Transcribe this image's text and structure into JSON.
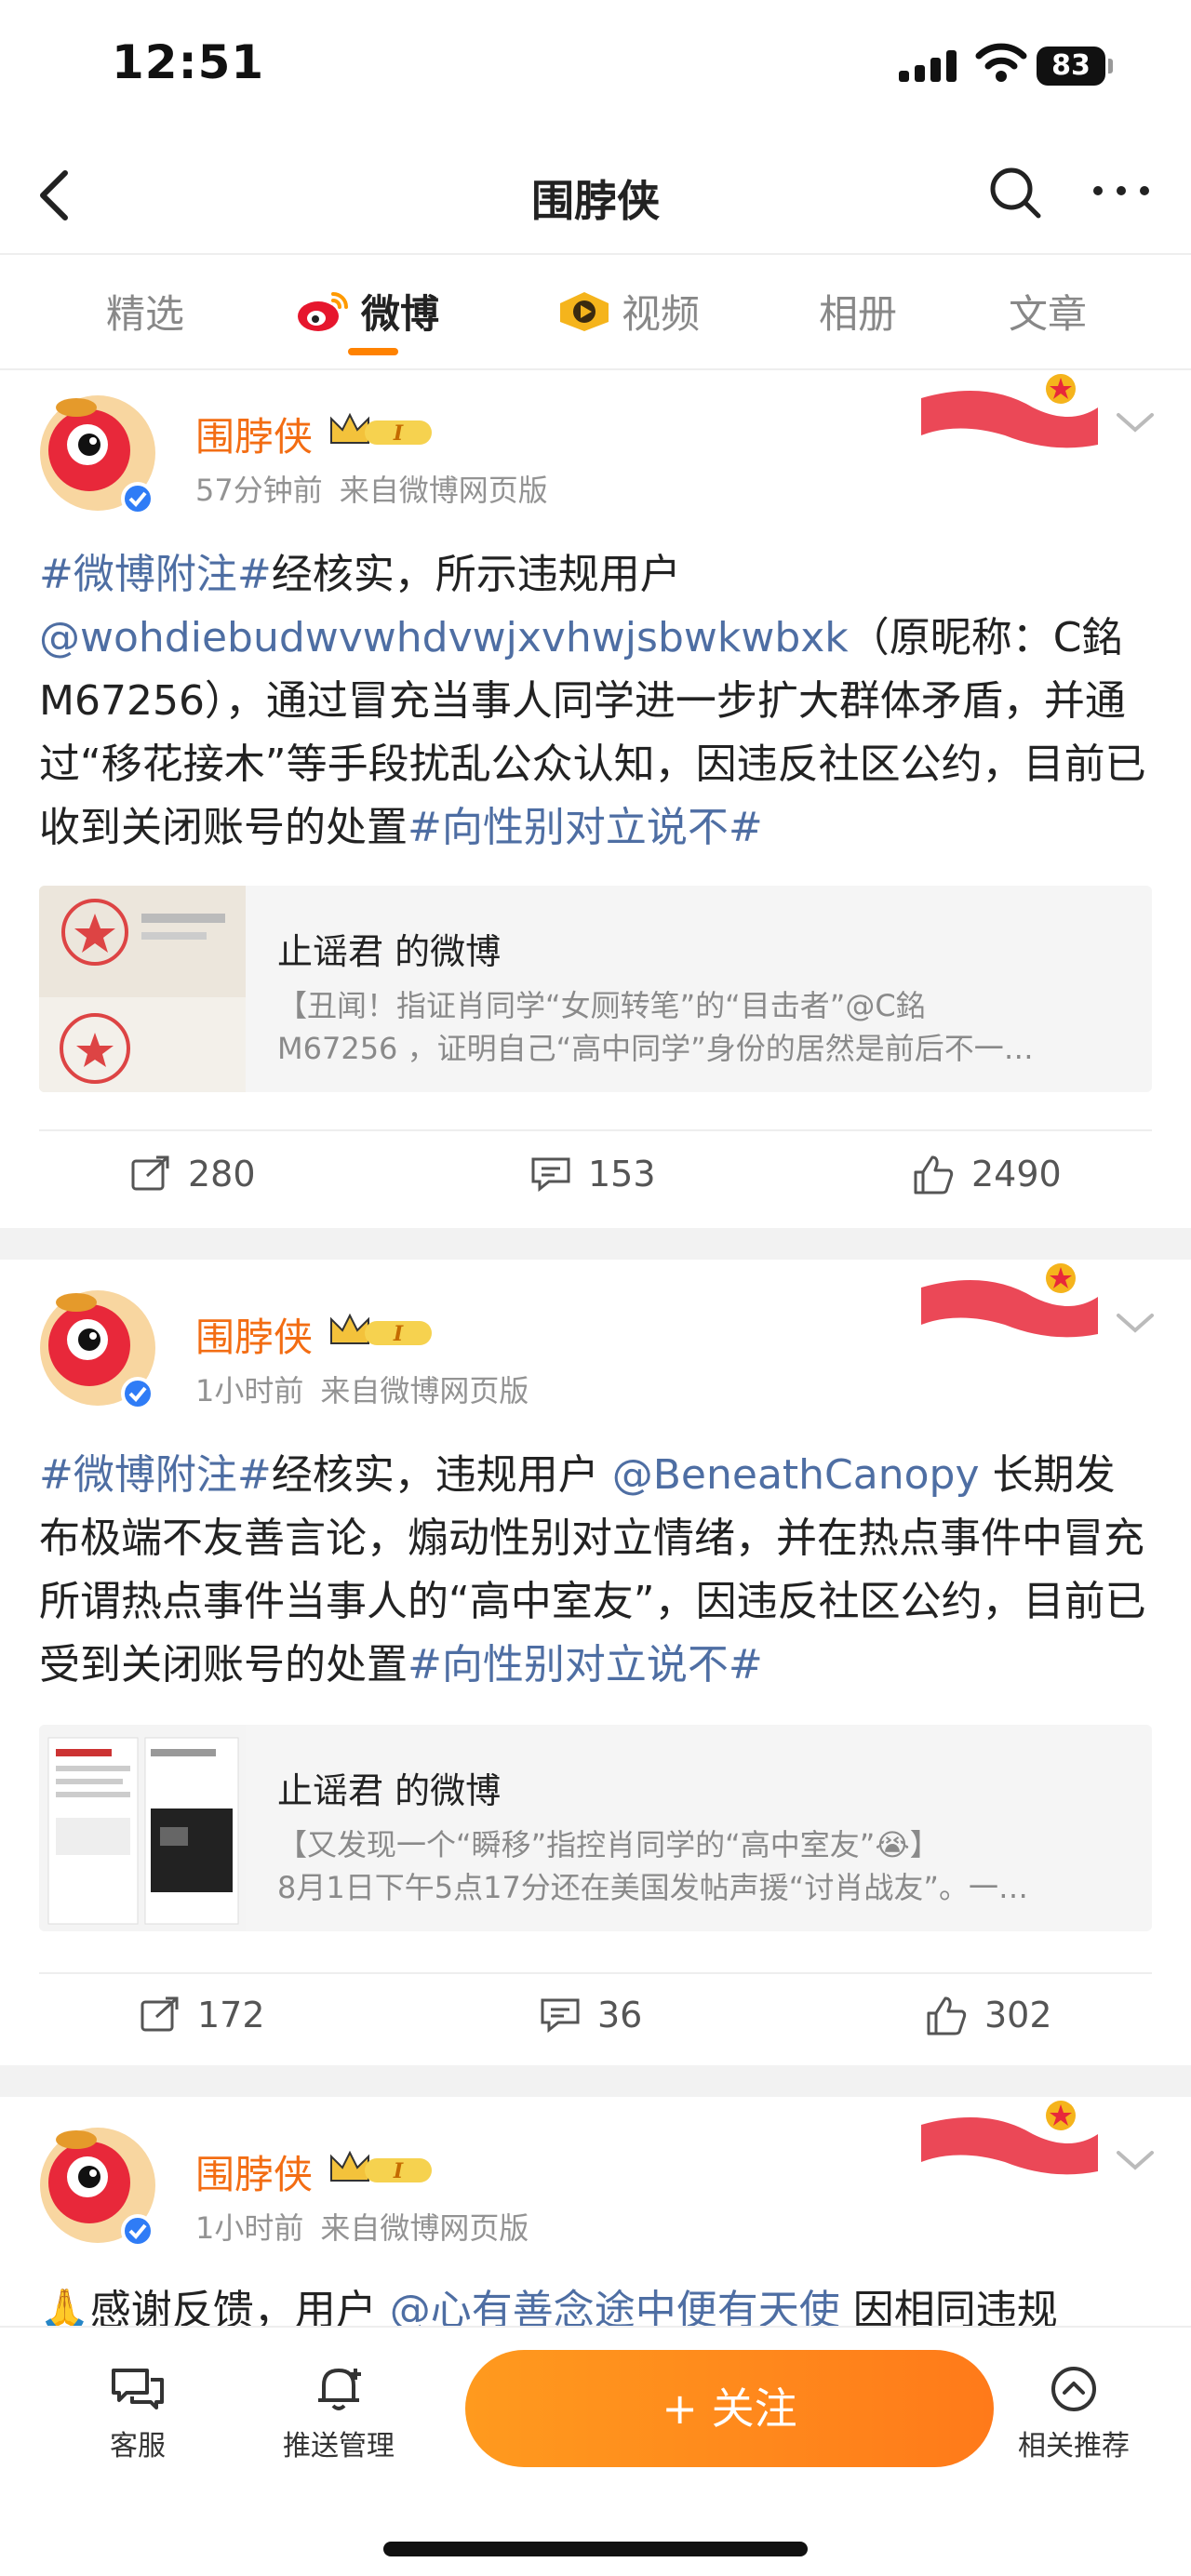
{
  "status": {
    "time": "12:51",
    "battery": "83"
  },
  "nav": {
    "title": "围脖侠"
  },
  "tabs": [
    {
      "label": "精选"
    },
    {
      "label": "微博"
    },
    {
      "label": "视频"
    },
    {
      "label": "相册"
    },
    {
      "label": "文章"
    }
  ],
  "posts": [
    {
      "username": "围脖侠",
      "time": "57分钟前",
      "source": "来自微博网页版",
      "text_parts": [
        "#微博附注#",
        "经核实，所示违规用户",
        "@wohdiebudwvwhdvwjxvhwjsbwkwbxk",
        "（原昵称：C銘M67256），通过冒充当事人同学进一步扩大群体矛盾，并通过“移花接木”等手段扰乱公众认知，因违反社区公约，目前已收到关闭账号的处置",
        "#向性别对立说不#"
      ],
      "quote": {
        "title": "止谣君 的微博",
        "line1": "【丑闻！指证肖同学“女厕转笔”的“目击者”@C銘",
        "line2": "M67256 ，证明自己“高中同学”身份的居然是前后不一…"
      },
      "reposts": "280",
      "comments": "153",
      "likes": "2490"
    },
    {
      "username": "围脖侠",
      "time": "1小时前",
      "source": "来自微博网页版",
      "text_parts": [
        "#微博附注#",
        "经核实，违规用户 ",
        "@BeneathCanopy",
        " 长期发布极端不友善言论，煽动性别对立情绪，并在热点事件中冒充所谓热点事件当事人的“高中室友”，因违反社区公约，目前已受到关闭账号的处置",
        "#向性别对立说不#"
      ],
      "quote": {
        "title": "止谣君 的微博",
        "line1": "【又发现一个“瞬移”指控肖同学的“高中室友”😭】",
        "line2": "8月1日下午5点17分还在美国发帖声援“讨肖战友”。一…"
      },
      "reposts": "172",
      "comments": "36",
      "likes": "302"
    },
    {
      "username": "围脖侠",
      "time": "1小时前",
      "source": "来自微博网页版",
      "text_parts": [
        "🙏感谢反馈，用户 ",
        "@心有善念途中便有天使",
        " 因相同违规"
      ]
    }
  ],
  "bottom": {
    "service": "客服",
    "push": "推送管理",
    "follow": "+ 关注",
    "related": "相关推荐"
  },
  "colors": {
    "accent": "#ff8200",
    "username": "#f36d13",
    "link": "#4e6ea3"
  }
}
